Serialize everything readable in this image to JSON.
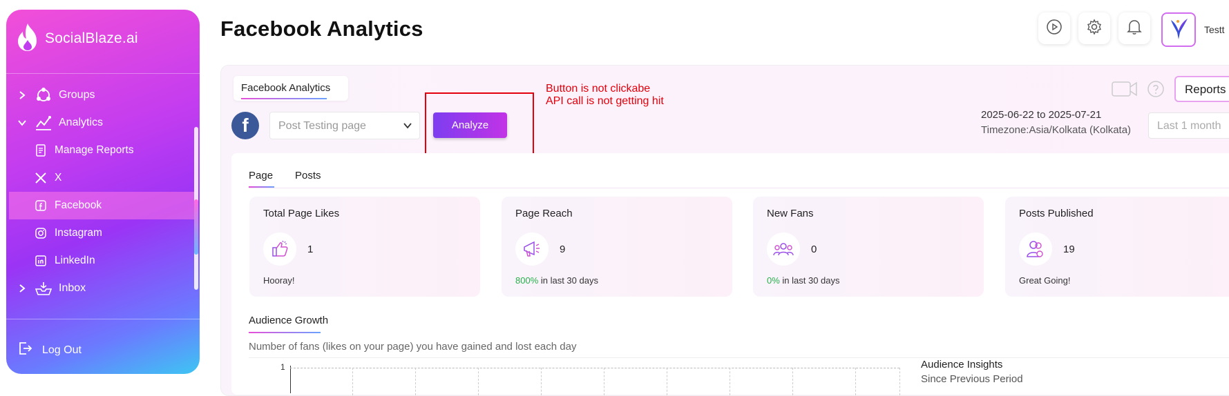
{
  "sidebar": {
    "brand": "SocialBlaze.ai",
    "items": [
      {
        "label": "Groups"
      },
      {
        "label": "Analytics"
      },
      {
        "label": "Manage Reports"
      },
      {
        "label": "X"
      },
      {
        "label": "Facebook"
      },
      {
        "label": "Instagram"
      },
      {
        "label": "LinkedIn"
      },
      {
        "label": "Inbox"
      }
    ],
    "logout": "Log Out"
  },
  "header": {
    "title": "Facebook Analytics",
    "user_name": "Testt"
  },
  "panel": {
    "tab": "Facebook Analytics",
    "page_select_value": "Post Testing page",
    "analyze_label": "Analyze",
    "annotation_line1": "Button is not clickabe",
    "annotation_line2": "API call is not getting hit",
    "reports_label": "Reports",
    "date_range": "2025-06-22 to 2025-07-21",
    "timezone": "Timezone:Asia/Kolkata (Kolkata)",
    "period_value": "Last 1 month"
  },
  "tabs": [
    "Page",
    "Posts"
  ],
  "cards": [
    {
      "title": "Total Page Likes",
      "value": "1",
      "pct": "",
      "footer": "Hooray!",
      "icon": "thumbs-up-icon"
    },
    {
      "title": "Page Reach",
      "value": "9",
      "pct": "800%",
      "footer": " in last 30 days",
      "icon": "megaphone-icon"
    },
    {
      "title": "New Fans",
      "value": "0",
      "pct": "0%",
      "footer": " in last 30 days",
      "icon": "users-icon"
    },
    {
      "title": "Posts Published",
      "value": "19",
      "pct": "",
      "footer": "Great Going!",
      "icon": "user-group-icon"
    }
  ],
  "audience": {
    "title": "Audience Growth",
    "description": "Number of fans (likes on your page) you have gained and lost each day",
    "y_tick": "1",
    "insights_title": "Audience Insights",
    "insights_sub": "Since Previous Period"
  },
  "colors": {
    "accent": "#c233e6",
    "facebook": "#3b5998",
    "annotation": "#e3000b",
    "positive": "#27b04a"
  }
}
